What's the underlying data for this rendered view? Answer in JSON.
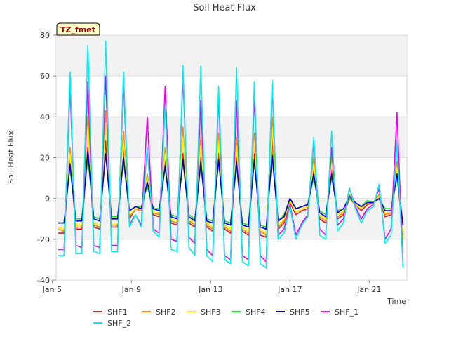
{
  "chart_data": {
    "type": "line",
    "title": "Soil Heat Flux",
    "xlabel": "Time",
    "ylabel": "Soil Heat Flux",
    "badge": "TZ_fmet",
    "xlim": [
      5.2,
      22.9
    ],
    "ylim": [
      -40,
      80
    ],
    "x_ticks": [
      {
        "x": 5,
        "label": "Jan 5"
      },
      {
        "x": 9,
        "label": "Jan 9"
      },
      {
        "x": 13,
        "label": "Jan 13"
      },
      {
        "x": 17,
        "label": "Jan 17"
      },
      {
        "x": 21,
        "label": "Jan 21"
      }
    ],
    "y_ticks": [
      -40,
      -20,
      0,
      20,
      40,
      60,
      80
    ],
    "grid": "horizontal bands",
    "legend_position": "bottom",
    "x_sample": [
      5.3,
      5.6,
      5.9,
      6.2,
      6.5,
      6.8,
      7.1,
      7.4,
      7.7,
      8.0,
      8.3,
      8.6,
      8.9,
      9.2,
      9.5,
      9.8,
      10.1,
      10.4,
      10.7,
      11.0,
      11.3,
      11.6,
      11.9,
      12.2,
      12.5,
      12.8,
      13.1,
      13.4,
      13.7,
      14.0,
      14.3,
      14.6,
      14.9,
      15.2,
      15.5,
      15.8,
      16.1,
      16.4,
      16.7,
      17.0,
      17.3,
      17.6,
      17.9,
      18.2,
      18.5,
      18.8,
      19.1,
      19.4,
      19.7,
      20.0,
      20.3,
      20.6,
      20.9,
      21.2,
      21.5,
      21.8,
      22.1,
      22.4,
      22.7
    ],
    "series": [
      {
        "name": "SHF1",
        "color": "#e31a1c",
        "values": [
          -17,
          -17,
          20,
          -15,
          -15,
          25,
          -14,
          -15,
          28,
          -14,
          -14,
          25,
          -10,
          -5,
          -6,
          8,
          -8,
          -9,
          18,
          -12,
          -13,
          22,
          -12,
          -14,
          20,
          -14,
          -16,
          22,
          -15,
          -17,
          20,
          -16,
          -18,
          22,
          -18,
          -19,
          30,
          -15,
          -12,
          -2,
          -8,
          -6,
          -5,
          15,
          -10,
          -12,
          15,
          -10,
          -8,
          0,
          -3,
          -6,
          -3,
          -2,
          0,
          -9,
          -8,
          12,
          -18
        ]
      },
      {
        "name": "SHF2",
        "color": "#ff8c00",
        "values": [
          -15,
          -16,
          25,
          -14,
          -14,
          40,
          -13,
          -14,
          43,
          -13,
          -13,
          33,
          -9,
          -5,
          -6,
          12,
          -7,
          -8,
          25,
          -11,
          -12,
          35,
          -11,
          -13,
          30,
          -13,
          -15,
          32,
          -14,
          -16,
          30,
          -15,
          -17,
          32,
          -16,
          -18,
          40,
          -14,
          -11,
          -1,
          -7,
          -5,
          -4,
          20,
          -9,
          -11,
          20,
          -9,
          -7,
          2,
          -3,
          -5,
          -2,
          -2,
          2,
          -8,
          -7,
          18,
          -20
        ]
      },
      {
        "name": "SHF3",
        "color": "#ffee00",
        "values": [
          -14,
          -15,
          22,
          -13,
          -13,
          35,
          -12,
          -13,
          37,
          -12,
          -12,
          28,
          -8,
          -5,
          -5,
          10,
          -7,
          -7,
          22,
          -10,
          -11,
          30,
          -10,
          -12,
          26,
          -12,
          -14,
          28,
          -13,
          -15,
          26,
          -14,
          -16,
          28,
          -15,
          -17,
          35,
          -13,
          -10,
          -1,
          -7,
          -5,
          -4,
          17,
          -8,
          -10,
          17,
          -8,
          -6,
          1,
          -3,
          -5,
          -2,
          -2,
          1,
          -7,
          -6,
          15,
          -16
        ]
      },
      {
        "name": "SHF4",
        "color": "#22dd22",
        "values": [
          -12,
          -12,
          15,
          -10,
          -10,
          20,
          -9,
          -10,
          22,
          -9,
          -9,
          18,
          -6,
          -4,
          -4,
          6,
          -5,
          -5,
          15,
          -8,
          -9,
          18,
          -8,
          -10,
          16,
          -10,
          -11,
          18,
          -11,
          -12,
          16,
          -12,
          -13,
          18,
          -13,
          -14,
          22,
          -11,
          -8,
          0,
          -5,
          -4,
          -3,
          10,
          -6,
          -8,
          10,
          -6,
          -5,
          0,
          -2,
          -4,
          -1,
          -2,
          0,
          -5,
          -5,
          10,
          -12
        ]
      },
      {
        "name": "SHF5",
        "color": "#0000cc",
        "values": [
          -12,
          -12,
          17,
          -11,
          -11,
          23,
          -10,
          -11,
          22,
          -10,
          -10,
          20,
          -6,
          -4,
          -5,
          8,
          -5,
          -6,
          16,
          -9,
          -10,
          19,
          -9,
          -11,
          18,
          -11,
          -12,
          19,
          -12,
          -13,
          18,
          -13,
          -14,
          19,
          -14,
          -15,
          21,
          -11,
          -9,
          0,
          -5,
          -4,
          -3,
          12,
          -7,
          -9,
          12,
          -7,
          -5,
          1,
          -2,
          -4,
          -2,
          -2,
          0,
          -6,
          -6,
          12,
          -13
        ]
      },
      {
        "name": "SHF_1",
        "color": "#ee00ee",
        "values": [
          -25,
          -25,
          55,
          -23,
          -24,
          57,
          -23,
          -24,
          60,
          -23,
          -23,
          57,
          -13,
          -8,
          -13,
          40,
          -15,
          -17,
          55,
          -20,
          -21,
          60,
          -19,
          -22,
          48,
          -25,
          -28,
          50,
          -28,
          -30,
          48,
          -28,
          -30,
          50,
          -28,
          -31,
          55,
          -18,
          -15,
          -3,
          -18,
          -12,
          -8,
          28,
          -15,
          -18,
          25,
          -13,
          -10,
          5,
          -4,
          -10,
          -5,
          -3,
          5,
          -20,
          -15,
          42,
          -32
        ]
      },
      {
        "name": "SHF_2",
        "color": "#00eeee",
        "values": [
          -28,
          -28,
          62,
          -27,
          -27,
          75,
          -26,
          -27,
          77,
          -26,
          -26,
          62,
          -14,
          -8,
          -14,
          25,
          -16,
          -19,
          46,
          -25,
          -26,
          65,
          -24,
          -28,
          65,
          -28,
          -31,
          55,
          -30,
          -32,
          64,
          -31,
          -33,
          57,
          -32,
          -34,
          58,
          -20,
          -17,
          -4,
          -20,
          -13,
          -9,
          30,
          -18,
          -20,
          33,
          -16,
          -12,
          5,
          -5,
          -12,
          -6,
          -4,
          7,
          -22,
          -18,
          28,
          -34
        ]
      }
    ]
  }
}
